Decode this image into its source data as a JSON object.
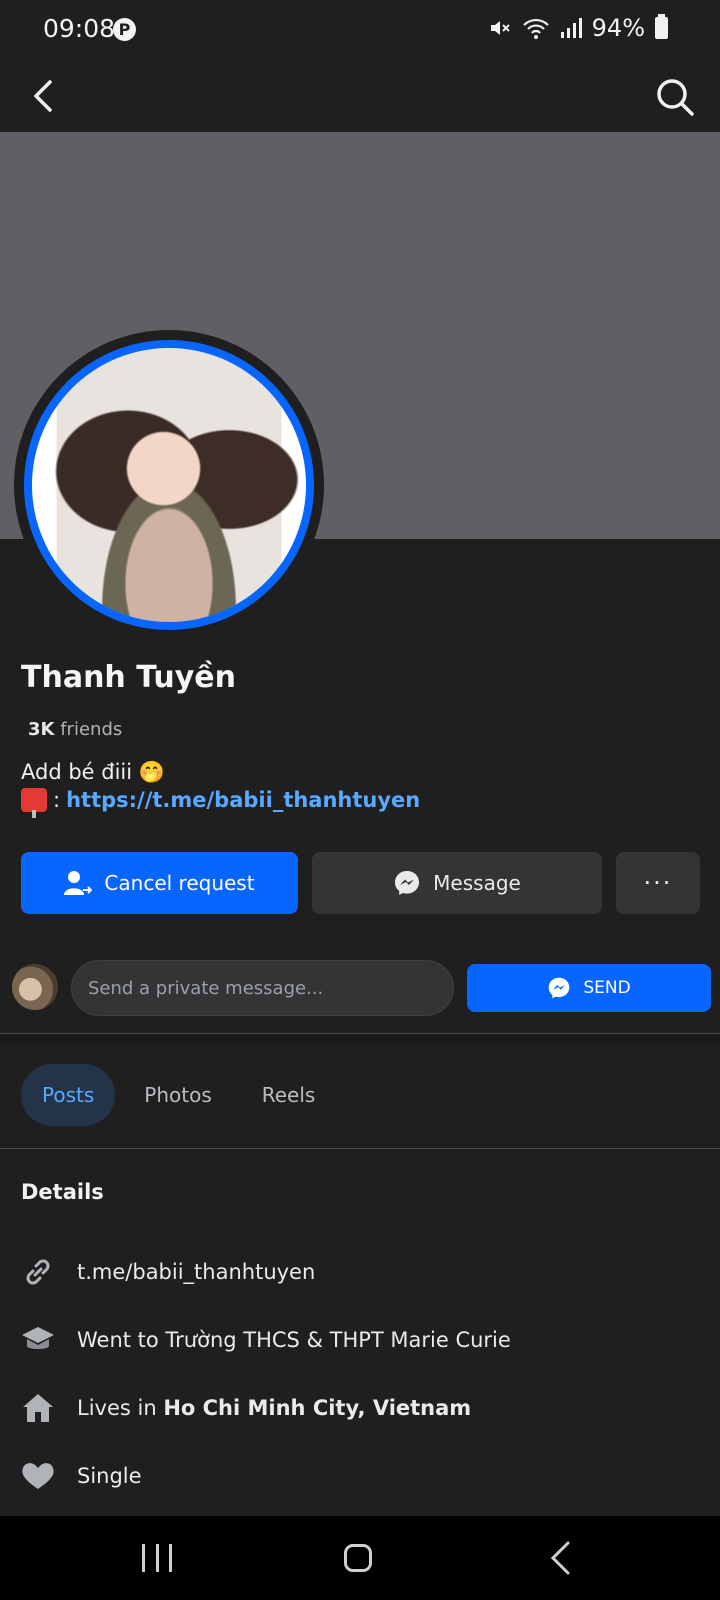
{
  "status_bar": {
    "time": "09:08",
    "battery": "94%",
    "icons": [
      "pinterest-icon",
      "mute-icon",
      "wifi-icon",
      "signal-icon",
      "battery-icon"
    ]
  },
  "top_nav": {
    "icons": [
      "back-icon",
      "search-icon"
    ]
  },
  "profile": {
    "name": "Thanh Tuyền",
    "friends_count": "3K",
    "friends_label": "friends",
    "bio_line1": "Add bé điii 🤭",
    "bio_link_prefix": ":",
    "bio_link": "https://t.me/babii_thanhtuyen"
  },
  "actions": {
    "cancel_request": "Cancel request",
    "message": "Message",
    "more": "···"
  },
  "private_message": {
    "placeholder": "Send a private message...",
    "send": "SEND"
  },
  "tabs": [
    {
      "label": "Posts",
      "active": true
    },
    {
      "label": "Photos",
      "active": false
    },
    {
      "label": "Reels",
      "active": false
    }
  ],
  "details": {
    "title": "Details",
    "link": "t.me/babii_thanhtuyen",
    "education": "Went to Trường THCS & THPT Marie Curie",
    "lives_prefix": "Lives in ",
    "lives_place": "Ho Chi Minh City, Vietnam",
    "relationship": "Single"
  },
  "colors": {
    "accent": "#0866ff",
    "background": "#1f1f1f",
    "cover": "#5f6065",
    "link": "#5aa9ff"
  }
}
